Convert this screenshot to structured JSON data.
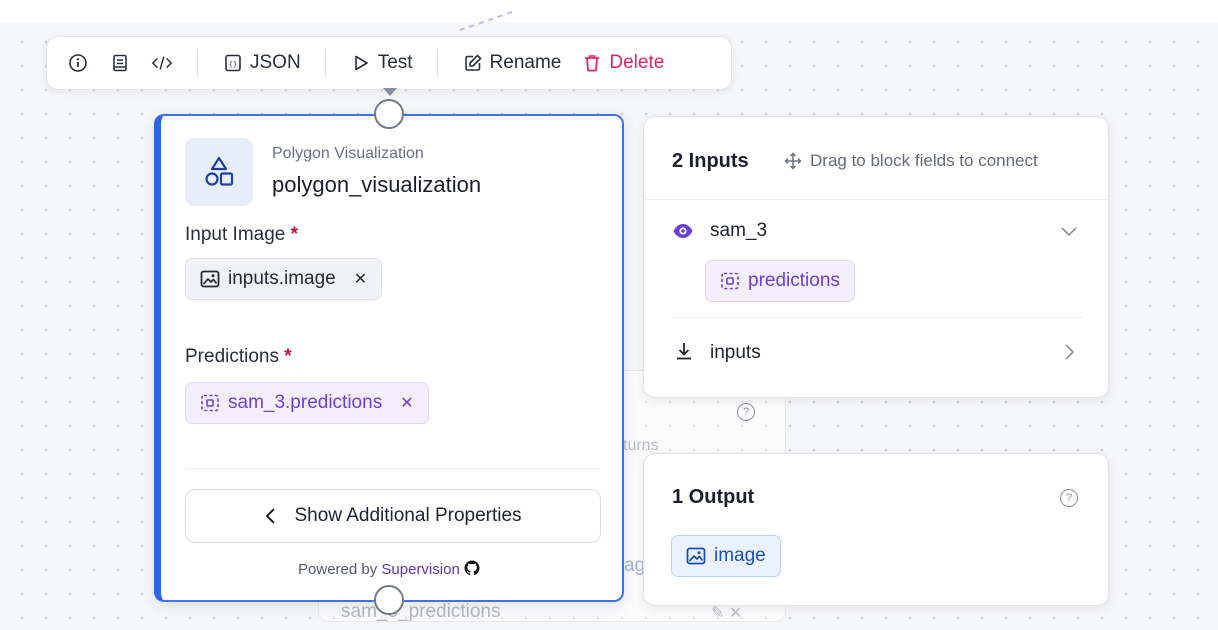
{
  "toolbar": {
    "json_label": "JSON",
    "test_label": "Test",
    "rename_label": "Rename",
    "delete_label": "Delete"
  },
  "background_node": {
    "returns_fragment": "turns",
    "image_fragment": "ag",
    "predictions_fragment": "sam_3_predictions"
  },
  "block": {
    "type_label": "Polygon Visualization",
    "name": "polygon_visualization",
    "fields": [
      {
        "label": "Input Image",
        "required_mark": "*",
        "value": "inputs.image",
        "icon": "image-icon"
      },
      {
        "label": "Predictions",
        "required_mark": "*",
        "value": "sam_3.predictions",
        "icon": "detection-icon"
      }
    ],
    "show_more_label": "Show Additional Properties",
    "powered_by_prefix": "Powered by",
    "powered_by_link": "Supervision"
  },
  "inputs_panel": {
    "title": "2 Inputs",
    "hint": "Drag to block fields to connect",
    "sources": [
      {
        "name": "sam_3",
        "icon": "eye-icon",
        "expanded": true,
        "outputs": [
          "predictions"
        ]
      },
      {
        "name": "inputs",
        "icon": "download-icon",
        "expanded": false
      }
    ]
  },
  "outputs_panel": {
    "title": "1 Output",
    "outputs": [
      "image"
    ]
  },
  "colors": {
    "accent_blue": "#2d63e6",
    "delete_red": "#e0245e",
    "purple": "#6b3fd8",
    "required_red": "#c0133b"
  }
}
